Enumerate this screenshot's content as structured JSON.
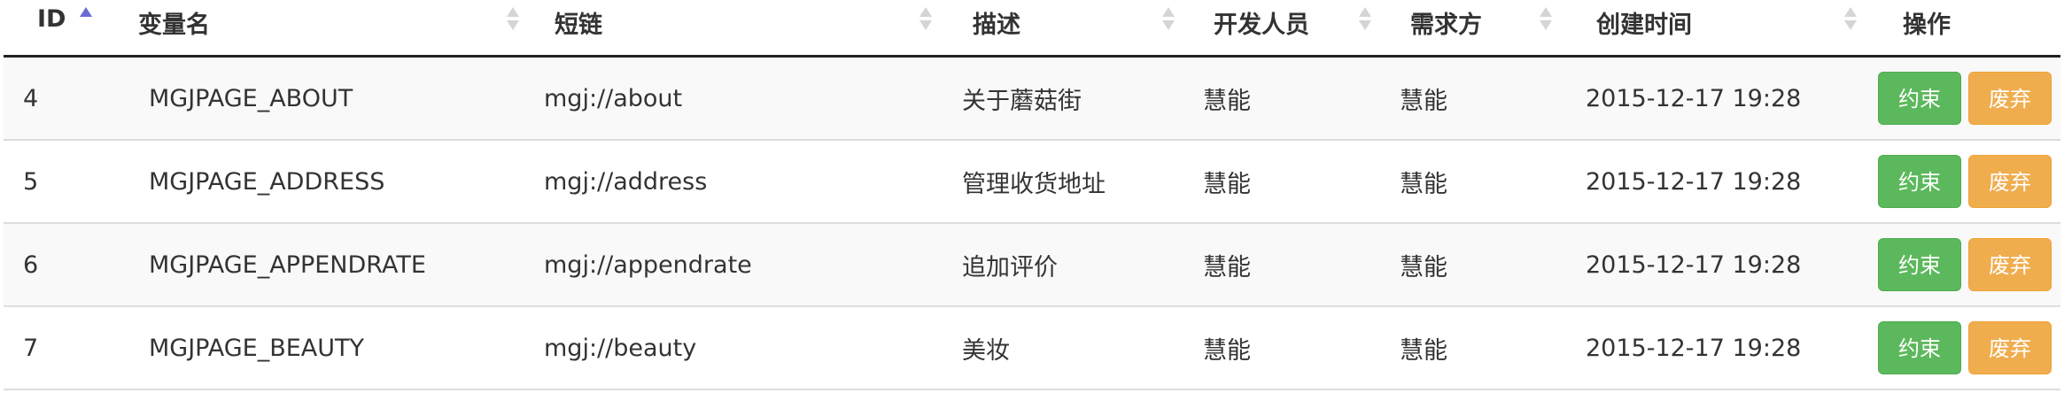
{
  "columns": [
    {
      "key": "id",
      "label": "ID",
      "sort": "asc"
    },
    {
      "key": "var",
      "label": "变量名",
      "sort": "both"
    },
    {
      "key": "link",
      "label": "短链",
      "sort": "both"
    },
    {
      "key": "desc",
      "label": "描述",
      "sort": "both"
    },
    {
      "key": "dev",
      "label": "开发人员",
      "sort": "both"
    },
    {
      "key": "req",
      "label": "需求方",
      "sort": "both"
    },
    {
      "key": "time",
      "label": "创建时间",
      "sort": "both"
    },
    {
      "key": "ops",
      "label": "操作",
      "sort": "none"
    }
  ],
  "actions": {
    "constrain_label": "约束",
    "discard_label": "废弃"
  },
  "colors": {
    "constrain": "#5cb85c",
    "discard": "#f0ad4e",
    "sort_active": "#6b6bd6"
  },
  "rows": [
    {
      "id": "4",
      "var": "MGJPAGE_ABOUT",
      "link": "mgj://about",
      "desc": "关于蘑菇街",
      "dev": "慧能",
      "req": "慧能",
      "time": "2015-12-17 19:28"
    },
    {
      "id": "5",
      "var": "MGJPAGE_ADDRESS",
      "link": "mgj://address",
      "desc": "管理收货地址",
      "dev": "慧能",
      "req": "慧能",
      "time": "2015-12-17 19:28"
    },
    {
      "id": "6",
      "var": "MGJPAGE_APPENDRATE",
      "link": "mgj://appendrate",
      "desc": "追加评价",
      "dev": "慧能",
      "req": "慧能",
      "time": "2015-12-17 19:28"
    },
    {
      "id": "7",
      "var": "MGJPAGE_BEAUTY",
      "link": "mgj://beauty",
      "desc": "美妆",
      "dev": "慧能",
      "req": "慧能",
      "time": "2015-12-17 19:28"
    }
  ]
}
